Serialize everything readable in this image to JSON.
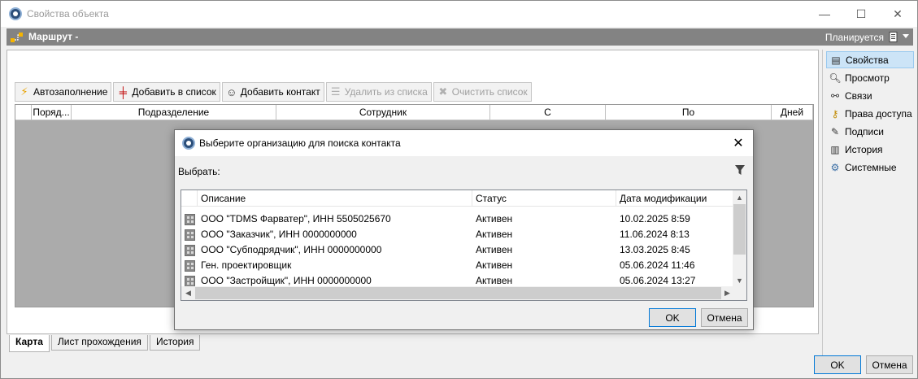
{
  "window": {
    "title": "Свойства объекта",
    "minimize": "—",
    "maximize": "☐",
    "close": "✕"
  },
  "header": {
    "route_title": "Маршрут -",
    "status": "Планируется"
  },
  "toolbar": {
    "autofill": "Автозаполнение",
    "add_to_list": "Добавить в список",
    "add_contact": "Добавить контакт",
    "remove_from_list": "Удалить из списка",
    "clear_list": "Очистить список"
  },
  "grid": {
    "columns": [
      "Поряд...",
      "Подразделение",
      "Сотрудник",
      "С",
      "По",
      "Дней"
    ]
  },
  "bottom_tabs": [
    "Карта",
    "Лист прохождения",
    "История"
  ],
  "right_panel": {
    "items": [
      "Свойства",
      "Просмотр",
      "Связи",
      "Права доступа",
      "Подписи",
      "История",
      "Системные"
    ]
  },
  "main_buttons": {
    "ok": "OK",
    "cancel": "Отмена"
  },
  "dialog": {
    "title": "Выберите организацию для поиска контакта",
    "select_label": "Выбрать:",
    "columns": [
      "Описание",
      "Статус",
      "Дата модификации"
    ],
    "rows": [
      {
        "description": "ООО \"TDMS Фарватер\", ИНН 5505025670",
        "status": "Активен",
        "modified": "10.02.2025 8:59"
      },
      {
        "description": "ООО \"Заказчик\", ИНН 0000000000",
        "status": "Активен",
        "modified": "11.06.2024 8:13"
      },
      {
        "description": "ООО \"Субподрядчик\", ИНН 0000000000",
        "status": "Активен",
        "modified": "13.03.2025 8:45"
      },
      {
        "description": "Ген. проектировщик",
        "status": "Активен",
        "modified": "05.06.2024 11:46"
      },
      {
        "description": "ООО \"Застройщик\", ИНН 0000000000",
        "status": "Активен",
        "modified": "05.06.2024 13:27"
      }
    ],
    "ok": "OK",
    "cancel": "Отмена"
  }
}
